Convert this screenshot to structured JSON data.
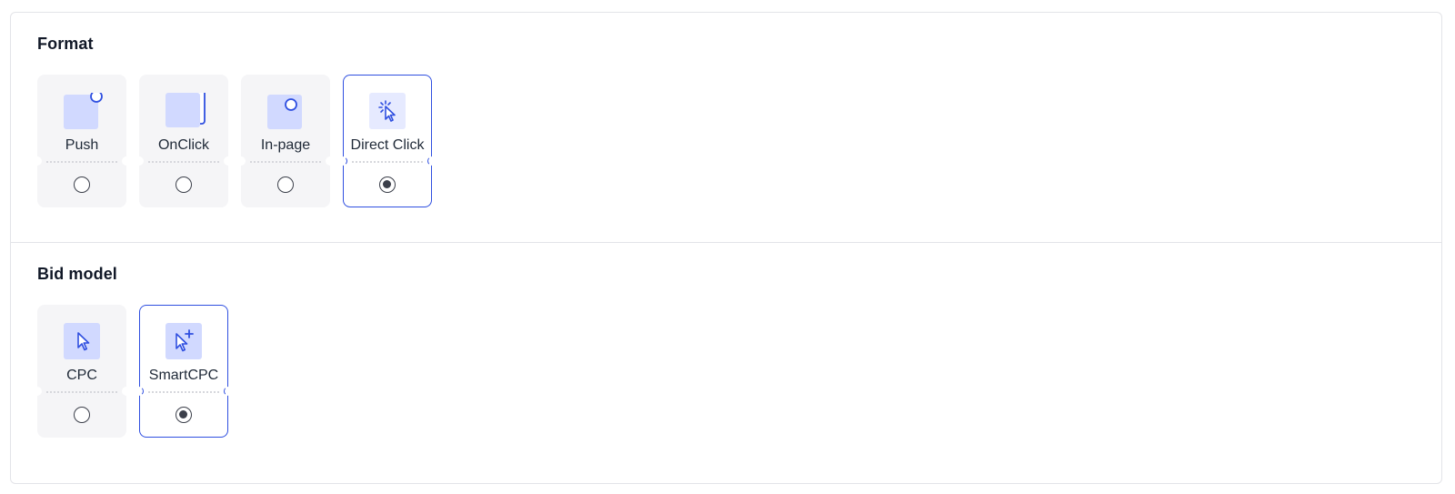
{
  "colors": {
    "accent": "#2f4fe0",
    "icon_fill": "#d1d9ff",
    "card_bg": "#f5f5f7",
    "border": "#e3e4e8"
  },
  "format": {
    "title": "Format",
    "options": [
      {
        "label": "Push",
        "icon": "push-icon",
        "selected": false
      },
      {
        "label": "OnClick",
        "icon": "onclick-icon",
        "selected": false
      },
      {
        "label": "In-page",
        "icon": "in-page-icon",
        "selected": false
      },
      {
        "label": "Direct Click",
        "icon": "direct-click-icon",
        "selected": true
      }
    ]
  },
  "bid_model": {
    "title": "Bid model",
    "options": [
      {
        "label": "CPC",
        "icon": "cursor-icon",
        "selected": false
      },
      {
        "label": "SmartCPC",
        "icon": "cursor-plus-icon",
        "selected": true
      }
    ]
  }
}
